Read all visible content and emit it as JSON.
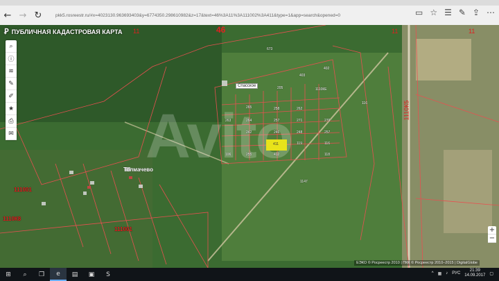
{
  "browser": {
    "url_host": "pkk5.rosreestr.ru",
    "url_full": "pkk5.rosreestr.ru/#x=4023130.963693403&y=6774350.298610982&z=17&text=46%3A11%3A111002%3A411&type=1&app=search&opened=0",
    "back_icon": "arrow-left-icon",
    "forward_icon": "arrow-right-icon",
    "refresh_icon": "refresh-icon",
    "right_icons": [
      "reading-view-icon",
      "favorite-star-icon",
      "favorites-list-icon",
      "notes-icon",
      "share-icon",
      "more-icon"
    ]
  },
  "map": {
    "title": "ПУБЛИЧНАЯ КАДАСТРОВАЯ КАРТА",
    "watermark": "Avito",
    "district_labels": [
      "46",
      "11",
      "11",
      "11"
    ],
    "parcel_labels": [
      "673",
      "403",
      "402",
      "1110КЕ",
      "265",
      "205",
      "258",
      "262",
      "263",
      "264",
      "257",
      "271",
      "270",
      "242",
      "246",
      "248",
      "257",
      "106",
      "255",
      "412",
      "1147",
      "116",
      "119",
      "118",
      "116",
      "1110К5",
      "111001",
      "1110К8",
      "111001"
    ],
    "highlighted_parcel": "411",
    "place_label": "Спасское",
    "village_label": "Толмачево",
    "attribution": "ЕЭКО © Росреестр 2010 | ПКК © Росреестр 2010–2015 | DigitalGlobe"
  },
  "toolbar": {
    "tools": [
      {
        "name": "search-icon",
        "glyph": "⌕"
      },
      {
        "name": "info-icon",
        "glyph": "ⓘ"
      },
      {
        "name": "layers-icon",
        "glyph": "≋"
      },
      {
        "name": "measure-icon",
        "glyph": "✎"
      },
      {
        "name": "draw-icon",
        "glyph": "✐"
      },
      {
        "name": "favorites-icon",
        "glyph": "★"
      },
      {
        "name": "print-icon",
        "glyph": "⎙"
      },
      {
        "name": "mail-icon",
        "glyph": "✉"
      }
    ]
  },
  "zoom": {
    "in": "+",
    "out": "−"
  },
  "taskbar": {
    "time": "21:39",
    "date": "14.09.2017",
    "lang": "РУС",
    "apps": [
      "windows-start-icon",
      "search-icon",
      "task-view-icon",
      "edge-browser-icon",
      "file-explorer-icon",
      "store-icon",
      "skype-icon"
    ]
  }
}
